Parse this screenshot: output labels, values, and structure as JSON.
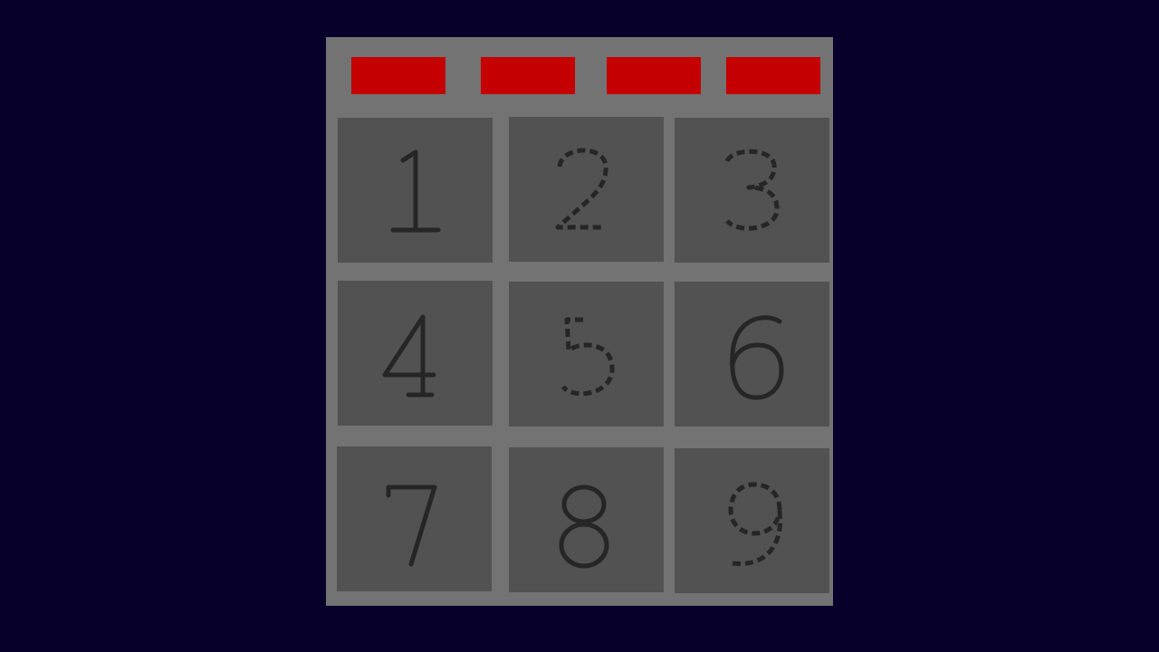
{
  "colors": {
    "background": "#06002b",
    "panel": "#737373",
    "key": "#525252",
    "digit": "#262626",
    "indicator": "#c40000"
  },
  "indicators": [
    {
      "state": "on"
    },
    {
      "state": "on"
    },
    {
      "state": "on"
    },
    {
      "state": "on"
    }
  ],
  "keypad": {
    "keys": [
      {
        "digit": "1",
        "style": "solid"
      },
      {
        "digit": "2",
        "style": "dashed"
      },
      {
        "digit": "3",
        "style": "dashed"
      },
      {
        "digit": "4",
        "style": "solid"
      },
      {
        "digit": "5",
        "style": "dashed"
      },
      {
        "digit": "6",
        "style": "solid"
      },
      {
        "digit": "7",
        "style": "solid"
      },
      {
        "digit": "8",
        "style": "solid"
      },
      {
        "digit": "9",
        "style": "dashed"
      }
    ]
  }
}
